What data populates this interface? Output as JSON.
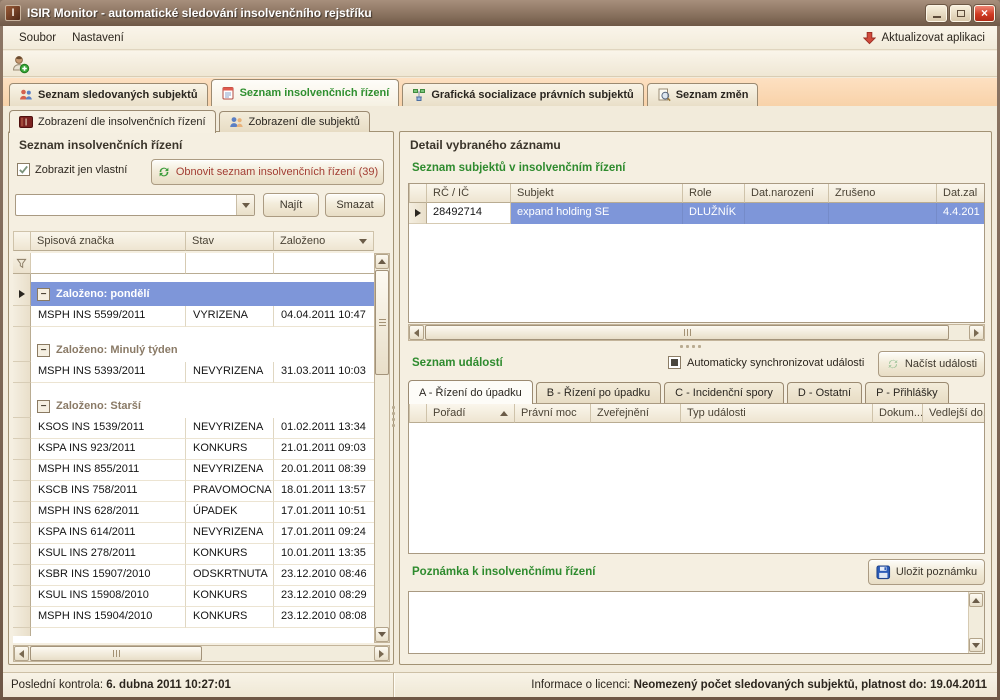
{
  "window": {
    "title": "ISIR Monitor - automatické sledování insolvenčního rejstříku",
    "app_icon_letter": "I"
  },
  "icons": {
    "close": "×",
    "collapse": "−"
  },
  "menu": {
    "soubor": "Soubor",
    "nastaveni": "Nastavení",
    "update": "Aktualizovat aplikaci"
  },
  "main_tabs": [
    {
      "label": "Seznam sledovaných subjektů"
    },
    {
      "label": "Seznam insolvenčních řízení"
    },
    {
      "label": "Grafická socializace právních subjektů"
    },
    {
      "label": "Seznam změn"
    }
  ],
  "sub_tabs": [
    {
      "label": "Zobrazení dle insolvenčních řízení"
    },
    {
      "label": "Zobrazení dle subjektů"
    }
  ],
  "left_panel": {
    "title": "Seznam insolvenčních řízení",
    "own_only_label": "Zobrazit jen vlastní",
    "refresh_button": "Obnovit seznam insolvenčních řízení (39)",
    "search": {
      "value": "",
      "find_button": "Najít",
      "clear_button": "Smazat"
    },
    "table": {
      "columns": [
        "Spisová značka",
        "Stav",
        "Založeno"
      ],
      "groups": [
        {
          "label": "Založeno: pondělí"
        },
        {
          "label": "Založeno: Minulý týden"
        },
        {
          "label": "Založeno: Starší"
        }
      ],
      "rows": [
        {
          "case": "MSPH INS 5599/2011",
          "state": "VYRIZENA",
          "created": "04.04.2011 10:47"
        },
        {
          "case": "MSPH INS 5393/2011",
          "state": "NEVYRIZENA",
          "created": "31.03.2011 10:03"
        },
        {
          "case": "KSOS INS 1539/2011",
          "state": "NEVYRIZENA",
          "created": "01.02.2011 13:34"
        },
        {
          "case": "KSPA INS 923/2011",
          "state": "KONKURS",
          "created": "21.01.2011 09:03"
        },
        {
          "case": "MSPH INS 855/2011",
          "state": "NEVYRIZENA",
          "created": "20.01.2011 08:39"
        },
        {
          "case": "KSCB INS 758/2011",
          "state": "PRAVOMOCNA",
          "created": "18.01.2011 13:57"
        },
        {
          "case": "MSPH INS 628/2011",
          "state": "ÚPADEK",
          "created": "17.01.2011 10:51"
        },
        {
          "case": "KSPA INS 614/2011",
          "state": "NEVYRIZENA",
          "created": "17.01.2011 09:24"
        },
        {
          "case": "KSUL INS 278/2011",
          "state": "KONKURS",
          "created": "10.01.2011 13:35"
        },
        {
          "case": "KSBR INS 15907/2010",
          "state": "ODSKRTNUTA",
          "created": "23.12.2010 08:46"
        },
        {
          "case": "KSUL INS 15908/2010",
          "state": "KONKURS",
          "created": "23.12.2010 08:29"
        },
        {
          "case": "MSPH INS 15904/2010",
          "state": "KONKURS",
          "created": "23.12.2010 08:08"
        }
      ]
    }
  },
  "detail": {
    "title": "Detail vybraného záznamu",
    "subjects": {
      "title": "Seznam subjektů v insolvenčním řízení",
      "columns": [
        "RČ / IČ",
        "Subjekt",
        "Role",
        "Dat.narození",
        "Zrušeno",
        "Dat.zal"
      ],
      "row": {
        "rc_ic": "28492714",
        "subject": "expand holding SE",
        "role": "DLUŽNÍK",
        "birth": "",
        "cancelled": "",
        "established": "4.4.201"
      }
    },
    "events": {
      "title": "Seznam událostí",
      "sync_label": "Automaticky synchronizovat události",
      "load_button": "Načíst události",
      "tabs": [
        {
          "label": "A - Řízení do úpadku"
        },
        {
          "label": "B - Řízení po úpadku"
        },
        {
          "label": "C - Incidenční spory"
        },
        {
          "label": "D - Ostatní"
        },
        {
          "label": "P - Přihlášky"
        }
      ],
      "columns": [
        "Pořadí",
        "Právní moc",
        "Zveřejnění",
        "Typ události",
        "Dokum...",
        "Vedlejší do..."
      ]
    },
    "note": {
      "title": "Poznámka k insolvenčnímu řízení",
      "save_button": "Uložit poznámku",
      "value": ""
    }
  },
  "status_bar": {
    "last_check_label": "Poslední kontrola:",
    "last_check_value": "6. dubna 2011 10:27:01",
    "license_label": "Informace o licenci:",
    "license_value": "Neomezený počet sledovaných subjektů, platnost do: 19.04.2011"
  },
  "colors": {
    "accent_green": "#2e8b2e",
    "refresh_text_red": "#a23d33",
    "selection_blue": "#7e96d9",
    "titlebar_brown": "#87705d"
  }
}
